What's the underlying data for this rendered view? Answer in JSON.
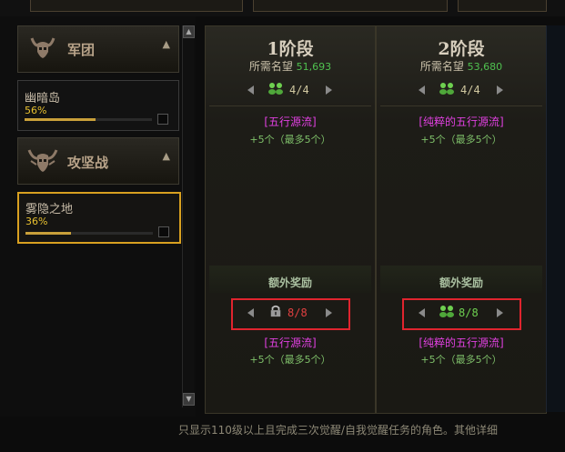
{
  "sidebar": {
    "groups": [
      {
        "title": "军团",
        "caret": "▲",
        "icon": "horned-skull-icon",
        "items": [
          {
            "name": "幽暗岛",
            "progress_text": "56%",
            "progress": 0.56
          }
        ]
      },
      {
        "title": "攻坚战",
        "caret": "▲",
        "icon": "winged-skull-icon",
        "items": [
          {
            "name": "雾隐之地",
            "progress_text": "36%",
            "progress": 0.36,
            "selected": true
          }
        ]
      }
    ]
  },
  "stages": [
    {
      "title": "1阶段",
      "req_label": "所需名望",
      "req_value": "51,693",
      "count": "4/4",
      "reward_name": "[五行源流]",
      "reward_qty": "+5个（最多5个）",
      "extra_label": "额外奖励",
      "extra_count": "8/8",
      "extra_locked": true,
      "extra_reward_name": "[五行源流]",
      "extra_reward_qty": "+5个（最多5个）"
    },
    {
      "title": "2阶段",
      "req_label": "所需名望",
      "req_value": "53,680",
      "count": "4/4",
      "reward_name": "[纯粹的五行源流]",
      "reward_qty": "+5个（最多5个）",
      "extra_label": "额外奖励",
      "extra_count": "8/8",
      "extra_locked": false,
      "extra_reward_name": "[纯粹的五行源流]",
      "extra_reward_qty": "+5个（最多5个）"
    }
  ],
  "footer": {
    "text": "只显示110级以上且完成三次觉醒/自我觉醒任务的角色。其他详细"
  },
  "colors": {
    "accent_gold": "#d8a020",
    "green": "#4fc04f",
    "magenta": "#e040e0",
    "highlight": "#e0242e"
  }
}
